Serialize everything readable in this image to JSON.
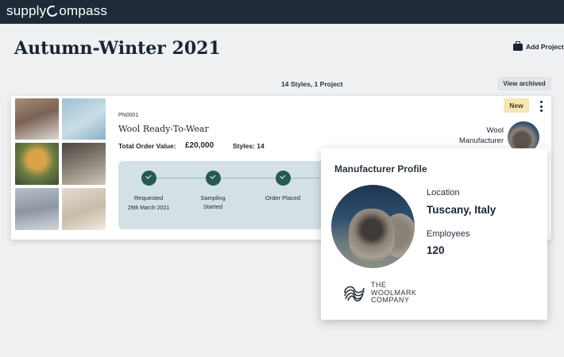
{
  "topbar": {
    "logo_prefix": "supply",
    "logo_suffix": "ompass"
  },
  "page": {
    "title": "Autumn-Winter 2021",
    "add_project_label": "Add Project"
  },
  "summary": {
    "text": "14 Styles, 1 Project",
    "view_archived_label": "View archived"
  },
  "project": {
    "code": "PN0001",
    "name": "Wool Ready-To-Wear",
    "order_value_label": "Total Order Value:",
    "order_value": "£20,000",
    "styles_label": "Styles: 14",
    "badge": "New",
    "manufacturer_line1": "Wool",
    "manufacturer_line2": "Manufacturer",
    "timeline": {
      "steps": [
        {
          "label": "Requested",
          "label2": "",
          "date": "29th March 2021"
        },
        {
          "label": "Sampling",
          "label2": "Started",
          "date": ""
        },
        {
          "label": "Order Placed",
          "label2": "",
          "date": ""
        }
      ]
    }
  },
  "manufacturer_profile": {
    "title": "Manufacturer Profile",
    "location_label": "Location",
    "location_value": "Tuscany, Italy",
    "employees_label": "Employees",
    "employees_value": "120",
    "certification_line1": "THE",
    "certification_line2": "WOOLMARK",
    "certification_line3": "COMPANY"
  },
  "colors": {
    "topbar": "#1e2a38",
    "accent_green": "#255a52",
    "timeline_bg": "#d3e1e6",
    "badge_bg": "#f6e6b5"
  },
  "icons": {
    "add_project": "briefcase-icon",
    "menu": "kebab-menu-icon",
    "step": "check-circle-icon",
    "certification": "woolmark-logo-icon"
  }
}
